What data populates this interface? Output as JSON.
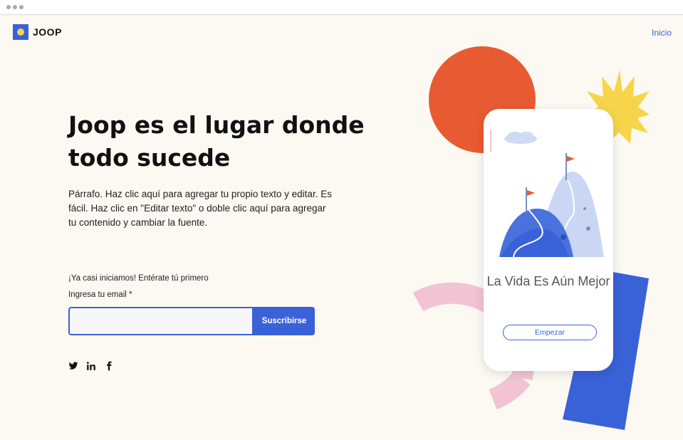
{
  "brand": {
    "name": "JOOP"
  },
  "nav": {
    "home_label": "Inicio"
  },
  "hero": {
    "title": "Joop es el lugar donde todo sucede",
    "paragraph": "Párrafo. Haz clic aquí para agregar tu propio texto y editar. Es fácil. Haz clic en \"Editar texto\" o doble clic aquí para agregar tu contenido y cambiar la fuente."
  },
  "signup": {
    "title": "¡Ya casi iniciamos! Entérate tú primero",
    "email_label": "Ingresa tu email *",
    "email_value": "",
    "submit_label": "Suscribirse"
  },
  "social": [
    {
      "icon": "twitter-icon"
    },
    {
      "icon": "linkedin-icon"
    },
    {
      "icon": "facebook-icon"
    }
  ],
  "phone": {
    "title": "La Vida Es Aún Mejor",
    "button_label": "Empezar"
  },
  "colors": {
    "accent": "#3a62d8",
    "orange": "#e85a32",
    "yellow": "#f6d54a",
    "pink": "#f2c4d3",
    "background": "#fcf9f3"
  }
}
